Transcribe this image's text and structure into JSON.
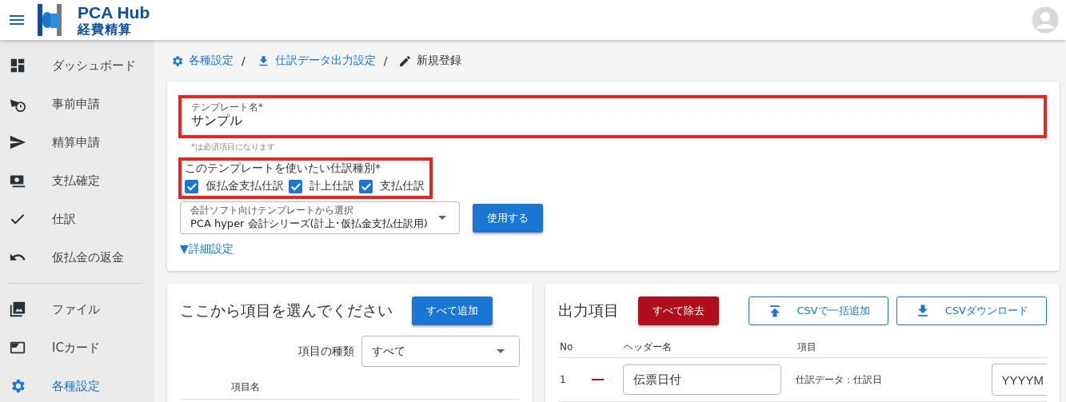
{
  "header": {
    "logo_title": "PCA Hub",
    "logo_subtitle": "経費精算"
  },
  "sidebar": {
    "items": [
      {
        "kind": "link",
        "label": "ダッシュボード",
        "selected": false
      },
      {
        "kind": "link",
        "label": "事前申請",
        "selected": false
      },
      {
        "kind": "link",
        "label": "精算申請",
        "selected": false
      },
      {
        "kind": "link",
        "label": "支払確定",
        "selected": false
      },
      {
        "kind": "link",
        "label": "仕訳",
        "selected": false
      },
      {
        "kind": "link",
        "label": "仮払金の返金",
        "selected": false
      },
      {
        "kind": "divider"
      },
      {
        "kind": "link",
        "label": "ファイル",
        "selected": false
      },
      {
        "kind": "link",
        "label": "ICカード",
        "selected": false
      },
      {
        "kind": "link",
        "label": "各種設定",
        "selected": true
      }
    ]
  },
  "breadcrumb": [
    {
      "kind": "link",
      "label": "各種設定"
    },
    {
      "kind": "separator",
      "label": "/"
    },
    {
      "kind": "link",
      "label": "仕訳データ出力設定"
    },
    {
      "kind": "separator",
      "label": "/"
    },
    {
      "kind": "current",
      "label": "新規登録"
    }
  ],
  "template_form": {
    "name_field": {
      "label": "テンプレート名*",
      "value": "サンプル",
      "highlighted": true
    },
    "required_note": "*は必須項目になります",
    "journal_types": {
      "label": "このテンプレートを使いたい仕訳種別*",
      "highlighted": true,
      "options": [
        {
          "label": "仮払金支払仕訳",
          "checked": true
        },
        {
          "label": "計上仕訳",
          "checked": true
        },
        {
          "label": "支払仕訳",
          "checked": true
        }
      ]
    },
    "software_select": {
      "label": "会計ソフト向けテンプレートから選択",
      "value": "PCA hyper 会計シリーズ(計上･仮払金支払仕訳用)"
    },
    "use_button": "使用する",
    "details_toggle": "▼詳細設定"
  },
  "item_picker": {
    "title": "ここから項目を選んでください",
    "add_all_button": "すべて追加",
    "type_filter": {
      "label": "項目の種類",
      "value": "すべて"
    },
    "columns": [
      "項目名"
    ]
  },
  "output_items": {
    "title": "出力項目",
    "remove_all_button": "すべて除去",
    "csv_import_button": "CSVで一括追加",
    "csv_download_button": "CSVダウンロード",
    "columns": [
      "No",
      "ヘッダー名",
      "項目"
    ],
    "rows": [
      {
        "no": "1",
        "header_name": "伝票日付",
        "item": "仕訳データ：仕訳日",
        "format": "YYYYM"
      }
    ]
  }
}
